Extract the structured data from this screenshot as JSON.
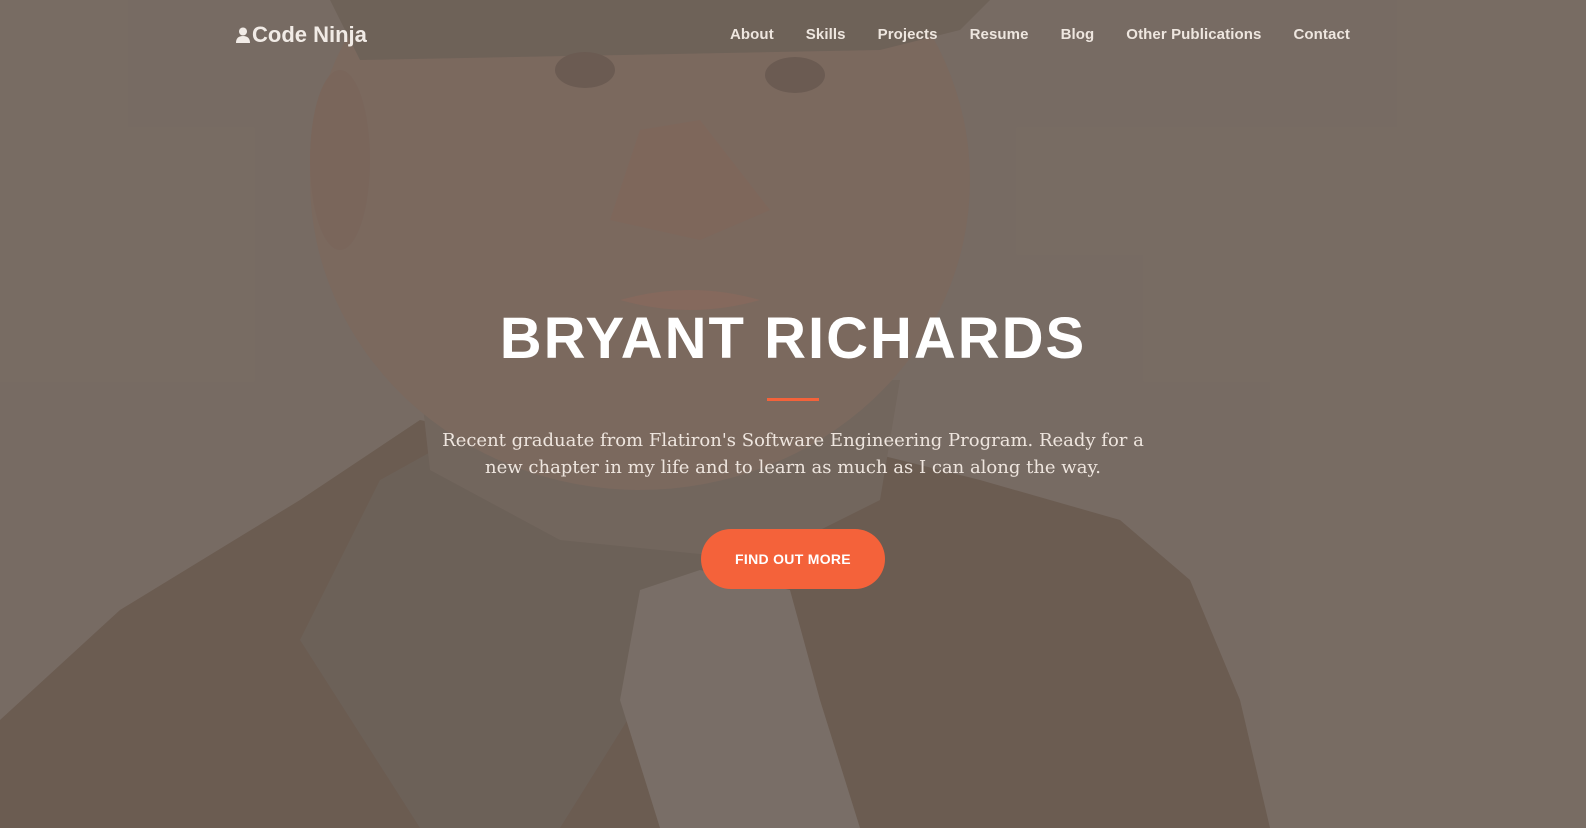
{
  "navbar": {
    "brand": "Code Ninja",
    "brand_icon": "user-icon",
    "links": [
      {
        "label": "About"
      },
      {
        "label": "Skills"
      },
      {
        "label": "Projects"
      },
      {
        "label": "Resume"
      },
      {
        "label": "Blog"
      },
      {
        "label": "Other Publications"
      },
      {
        "label": "Contact"
      }
    ]
  },
  "hero": {
    "title": "BRYANT RICHARDS",
    "subtitle": "Recent graduate from Flatiron's Software Engineering Program. Ready for a new chapter in my life and to learn as much as I can along the way.",
    "cta_label": "FIND OUT MORE"
  },
  "colors": {
    "accent": "#f4623a",
    "background": "#7a6e66",
    "text": "#ffffff"
  }
}
